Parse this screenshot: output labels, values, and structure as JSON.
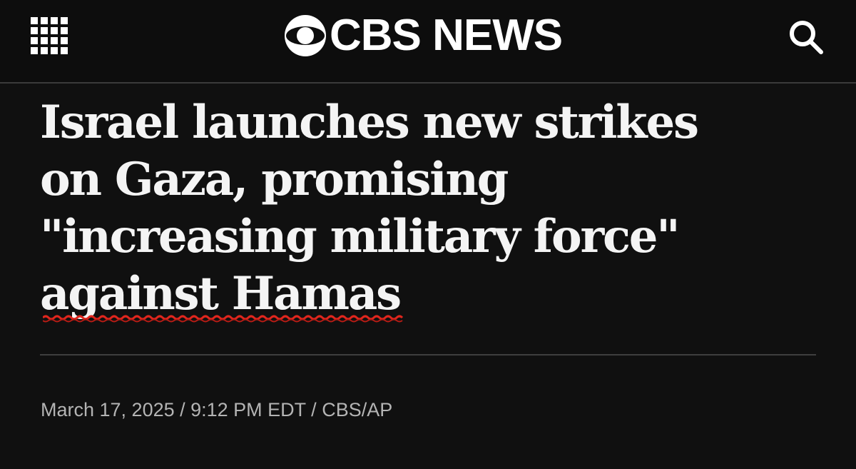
{
  "header": {
    "brand": "CBS NEWS",
    "menu_icon": "grid-menu-icon",
    "logo_icon": "cbs-eye-icon",
    "search_icon": "search-icon"
  },
  "article": {
    "headline_lines": [
      "Israel launches new strikes",
      "on Gaza, promising",
      "\"increasing military force\"",
      "against Hamas"
    ],
    "byline": "March 17, 2025 / 9:12 PM EDT / CBS/AP"
  },
  "colors": {
    "background": "#101010",
    "text": "#f4f4f4",
    "byline": "#b4b4b4",
    "spellcheck_underline": "#e0261d"
  }
}
